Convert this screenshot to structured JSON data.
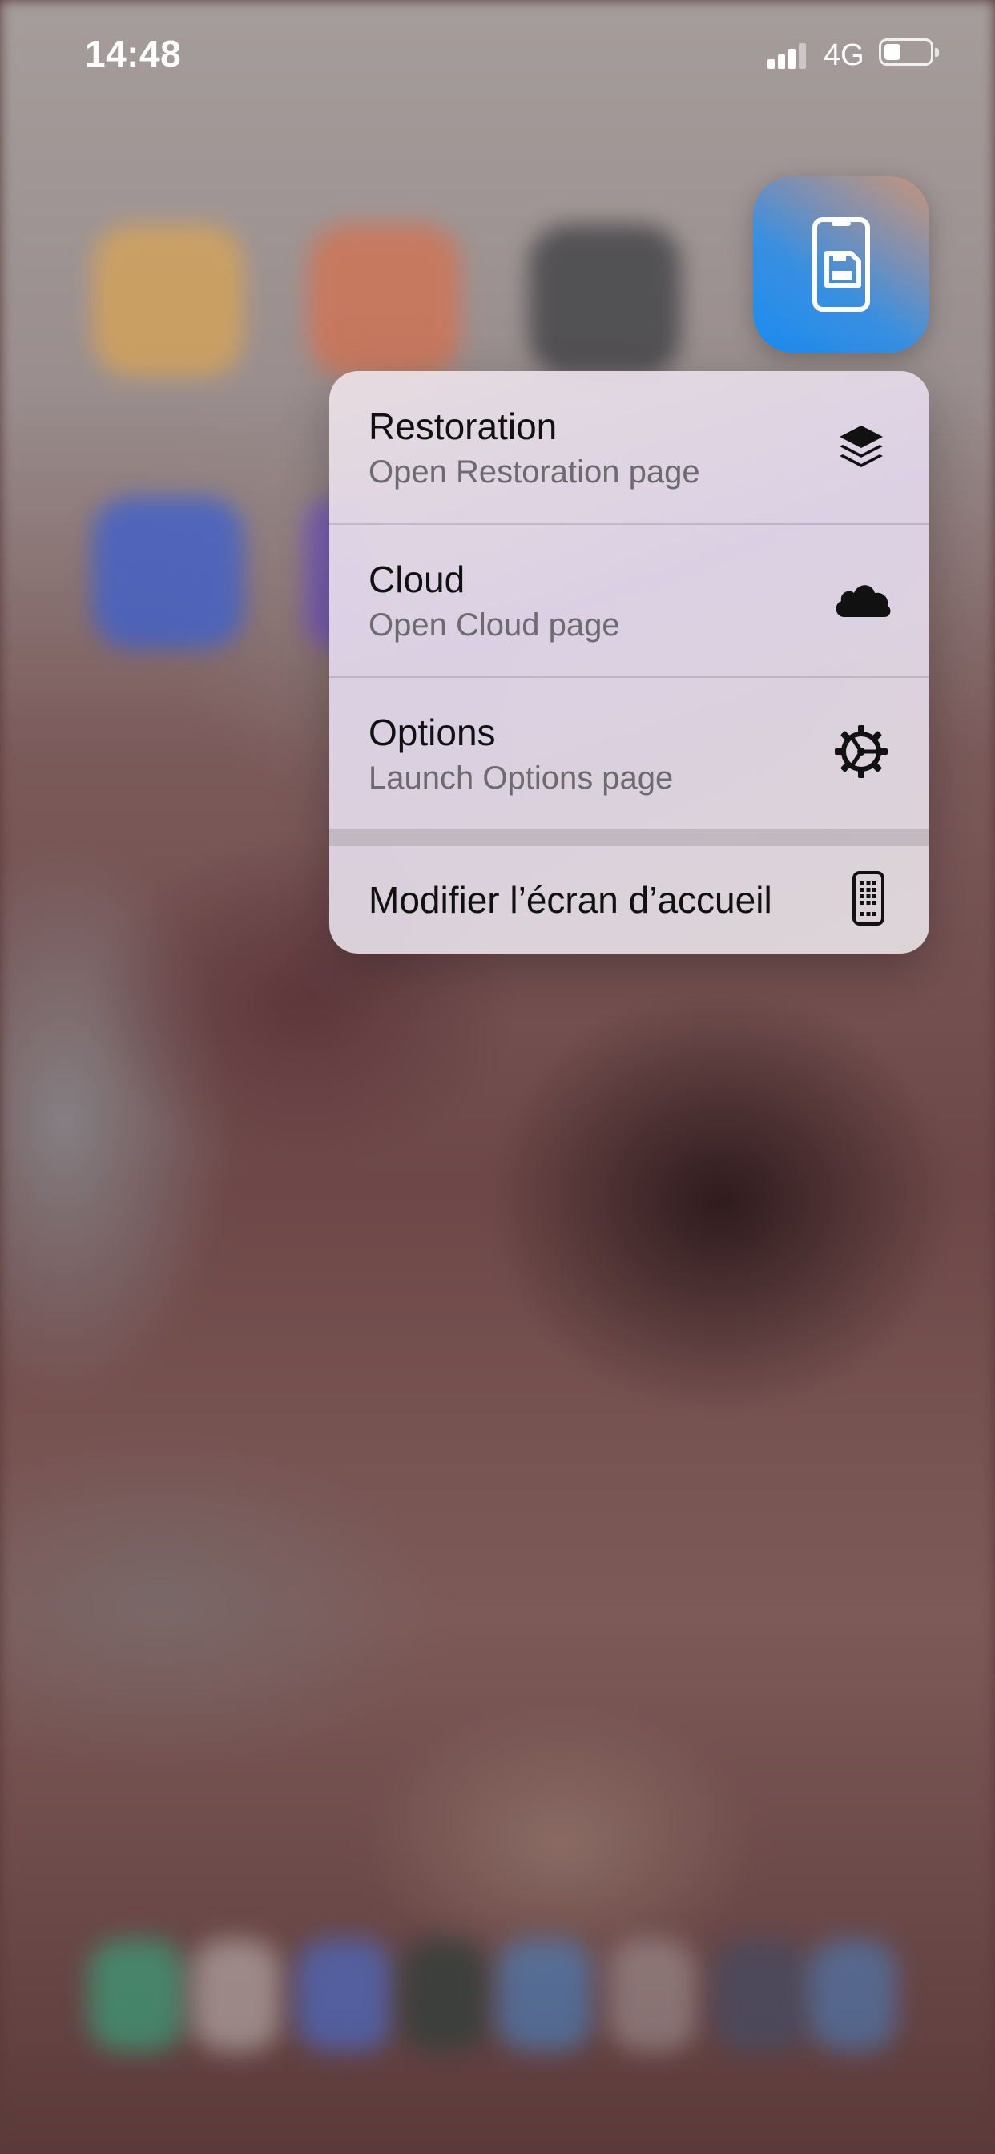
{
  "status_bar": {
    "time": "14:48",
    "network": "4G",
    "battery_level": 0.35
  },
  "app_icon": {
    "icon": "phone-save-icon",
    "gradient": [
      "#1a8cf0",
      "#c6967a"
    ]
  },
  "menu": {
    "items": [
      {
        "title": "Restoration",
        "subtitle": "Open Restoration page",
        "icon": "layers-icon"
      },
      {
        "title": "Cloud",
        "subtitle": "Open Cloud page",
        "icon": "cloud-icon"
      },
      {
        "title": "Options",
        "subtitle": "Launch Options page",
        "icon": "gear-icon"
      }
    ],
    "edit_home": {
      "title": "Modifier l’écran d’accueil",
      "icon": "phone-grid-icon"
    }
  }
}
